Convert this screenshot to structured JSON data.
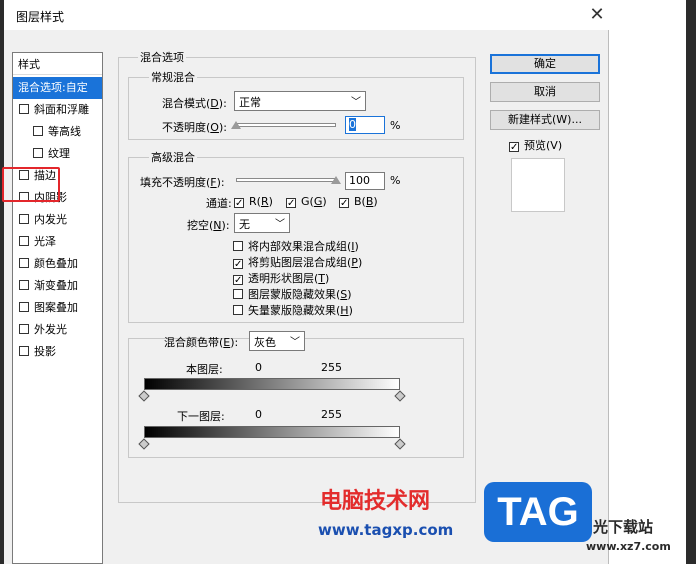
{
  "window": {
    "title": "图层样式"
  },
  "styles": {
    "header": "样式",
    "items": [
      {
        "label": "混合选项:自定",
        "checkbox": false,
        "selected": true,
        "indent": 0
      },
      {
        "label": "斜面和浮雕",
        "checkbox": true,
        "checked": false,
        "indent": 0
      },
      {
        "label": "等高线",
        "checkbox": true,
        "checked": false,
        "indent": 1
      },
      {
        "label": "纹理",
        "checkbox": true,
        "checked": false,
        "indent": 1
      },
      {
        "label": "描边",
        "checkbox": true,
        "checked": false,
        "indent": 0
      },
      {
        "label": "内阴影",
        "checkbox": true,
        "checked": false,
        "indent": 0
      },
      {
        "label": "内发光",
        "checkbox": true,
        "checked": false,
        "indent": 0
      },
      {
        "label": "光泽",
        "checkbox": true,
        "checked": false,
        "indent": 0
      },
      {
        "label": "颜色叠加",
        "checkbox": true,
        "checked": false,
        "indent": 0
      },
      {
        "label": "渐变叠加",
        "checkbox": true,
        "checked": false,
        "indent": 0
      },
      {
        "label": "图案叠加",
        "checkbox": true,
        "checked": false,
        "indent": 0
      },
      {
        "label": "外发光",
        "checkbox": true,
        "checked": false,
        "indent": 0
      },
      {
        "label": "投影",
        "checkbox": true,
        "checked": false,
        "indent": 0
      }
    ]
  },
  "blend": {
    "frame_title": "混合选项",
    "general": {
      "title": "常规混合",
      "mode_label": "混合模式(",
      "mode_key": "D",
      "mode_value": "正常",
      "opacity_label": "不透明度(",
      "opacity_key": "O",
      "opacity_value": "0",
      "opacity_unit": "%",
      "opacity_level": 0
    },
    "advanced": {
      "title": "高级混合",
      "fill_label": "填充不透明度(",
      "fill_key": "F",
      "fill_value": "100",
      "fill_unit": "%",
      "fill_level": 100,
      "channels_label": "通道:",
      "channels": [
        {
          "label": "R(",
          "key": "R",
          "checked": true
        },
        {
          "label": "G(",
          "key": "G",
          "checked": true
        },
        {
          "label": "B(",
          "key": "B",
          "checked": true
        }
      ],
      "knockout_label": "挖空(",
      "knockout_key": "N",
      "knockout_value": "无",
      "options": [
        {
          "label": "将内部效果混合成组(",
          "key": "I",
          "checked": false
        },
        {
          "label": "将剪贴图层混合成组(",
          "key": "P",
          "checked": true
        },
        {
          "label": "透明形状图层(",
          "key": "T",
          "checked": true
        },
        {
          "label": "图层蒙版隐藏效果(",
          "key": "S",
          "checked": false
        },
        {
          "label": "矢量蒙版隐藏效果(",
          "key": "H",
          "checked": false
        }
      ]
    },
    "blend_if": {
      "label": "混合颜色带(",
      "key": "E",
      "value": "灰色",
      "this_layer_label": "本图层:",
      "this_low": "0",
      "this_high": "255",
      "under_layer_label": "下一图层:",
      "under_low": "0",
      "under_high": "255"
    }
  },
  "buttons": {
    "ok": "确定",
    "cancel": "取消",
    "new_style": "新建样式(W)...",
    "preview_label": "预览(V)",
    "preview_checked": true
  },
  "watermark": {
    "brand": "电脑技术网",
    "url": "www.tagxp.com",
    "badge": "TAG",
    "right_text": "光下载站",
    "right_url": "www.xz7.com"
  },
  "colors": {
    "accent": "#1a73d9",
    "highlight": "#e3262b"
  }
}
